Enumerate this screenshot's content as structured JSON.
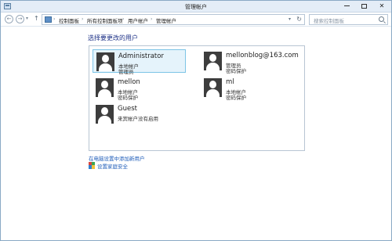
{
  "window": {
    "title": "管理帐户"
  },
  "address_bar": {
    "breadcrumbs": [
      "控制面板",
      "所有控制面板项",
      "用户帐户",
      "管理帐户"
    ],
    "separator": "›"
  },
  "search": {
    "placeholder": "搜索控制面板"
  },
  "main": {
    "heading": "选择要更改的用户",
    "accounts": [
      {
        "name": "Administrator",
        "line1": "本地帐户",
        "line2": "管理员",
        "selected": true
      },
      {
        "name": "mellonblog@163.com",
        "line1": "管理员",
        "line2": "密码保护",
        "selected": false
      },
      {
        "name": "mellon",
        "line1": "本地帐户",
        "line2": "密码保护",
        "selected": false
      },
      {
        "name": "ml",
        "line1": "本地帐户",
        "line2": "密码保护",
        "selected": false
      },
      {
        "name": "Guest",
        "line1": "来宾帐户没有启用",
        "line2": "",
        "selected": false
      }
    ],
    "add_user_link": "在电脑设置中添加新用户",
    "family_safety_link": "设置家庭安全"
  },
  "icons": {
    "app": "control-panel-icon",
    "back": "back-arrow-icon",
    "forward": "forward-arrow-icon",
    "up": "up-arrow-icon",
    "refresh": "refresh-icon",
    "search": "search-icon",
    "shield": "family-safety-shield-icon",
    "avatar": "user-avatar-icon"
  },
  "colors": {
    "heading": "#1e3287",
    "link": "#1c5bb8",
    "selected_bg": "#e5f3fb",
    "selected_border": "#7dc4e6",
    "titlebar": "#e4edf7"
  }
}
